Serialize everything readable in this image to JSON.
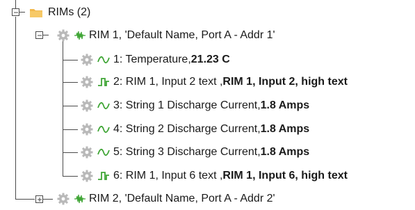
{
  "tree": {
    "root": {
      "label": "RIMs (2)",
      "expanded": true,
      "children": [
        {
          "label": "RIM 1, 'Default Name, Port A - Addr 1'",
          "expanded": true,
          "children": [
            {
              "label": "1: Temperature, ",
              "value": "21.23 C",
              "icon": "analog-wave-icon"
            },
            {
              "label": "2: RIM 1, Input 2 text , ",
              "value": "RIM 1, Input 2, high text",
              "icon": "digital-pulse-icon"
            },
            {
              "label": "3: String 1 Discharge Current, ",
              "value": "1.8 Amps",
              "icon": "analog-wave-icon"
            },
            {
              "label": "4: String 2 Discharge Current, ",
              "value": "1.8 Amps",
              "icon": "analog-wave-icon"
            },
            {
              "label": "5: String 3 Discharge Current, ",
              "value": "1.8 Amps",
              "icon": "analog-wave-icon"
            },
            {
              "label": "6: RIM 1, Input 6 text , ",
              "value": "RIM 1, Input 6, high text",
              "icon": "digital-pulse-icon"
            }
          ]
        },
        {
          "label": "RIM 2, 'Default Name, Port A - Addr 2'",
          "expanded": false,
          "children": []
        }
      ]
    }
  },
  "colors": {
    "folder": "#f2b84b",
    "gear": "#b9b9b9",
    "signal_green": "#3fa535",
    "line": "#4a4a4a"
  }
}
